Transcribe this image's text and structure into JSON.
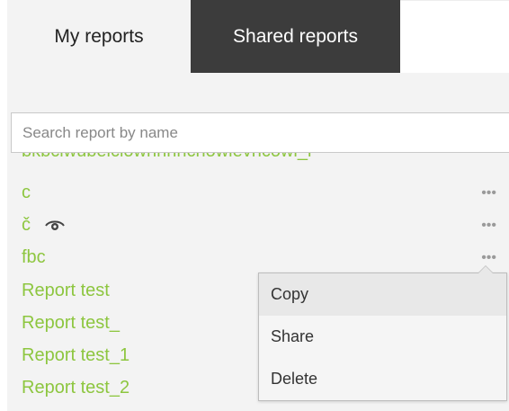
{
  "tabs": {
    "my_reports": "My reports",
    "shared_reports": "Shared reports"
  },
  "search": {
    "placeholder": "Search report by name",
    "value": ""
  },
  "reports": [
    {
      "name": "bkbciwubeiciowhhnhchowievhcowi_i",
      "shared": false
    },
    {
      "name": "c",
      "shared": false
    },
    {
      "name": "č",
      "shared": true
    },
    {
      "name": "fbc",
      "shared": false
    },
    {
      "name": "Report  test",
      "shared": false
    },
    {
      "name": "Report  test_",
      "shared": false
    },
    {
      "name": "Report  test_1",
      "shared": false
    },
    {
      "name": "Report  test_2",
      "shared": false
    }
  ],
  "more_label": "•••",
  "context_menu": {
    "items": [
      "Copy",
      "Share",
      "Delete"
    ],
    "highlighted": "Copy"
  },
  "colors": {
    "report_link": "#8dc63f",
    "active_tab_bg": "#3c3c3c"
  }
}
